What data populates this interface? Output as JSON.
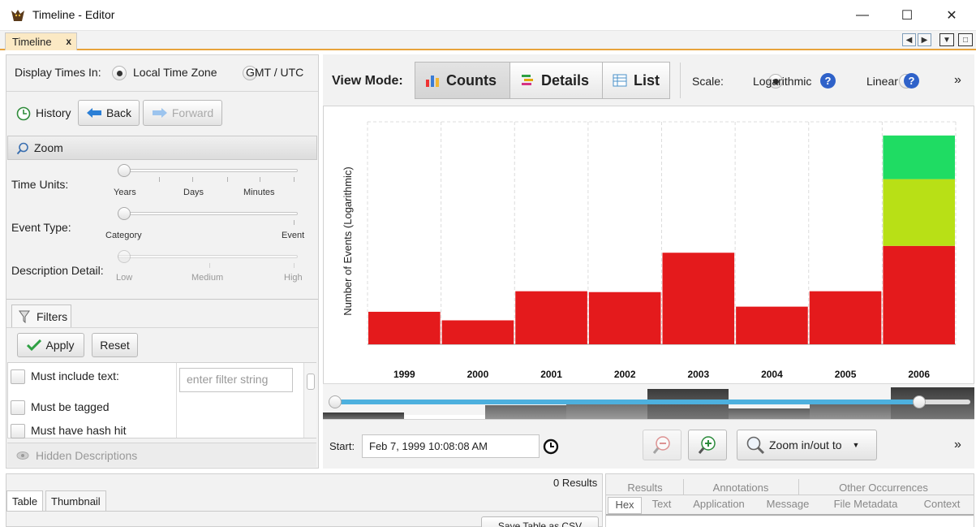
{
  "window": {
    "title": "Timeline - Editor",
    "minimize": "—",
    "maximize": "☐",
    "close": "✕"
  },
  "tabs": {
    "active_label": "Timeline",
    "close_glyph": "x",
    "nav_prev": "◀",
    "nav_next": "▶",
    "dropdown": "▼",
    "restore": "□"
  },
  "left": {
    "display_times_label": "Display Times In:",
    "tz_local": "Local Time Zone",
    "tz_gmt": "GMT / UTC",
    "tz_selected": "Local Time Zone",
    "history_label": "History",
    "back_label": "Back",
    "forward_label": "Forward",
    "zoom_label": "Zoom",
    "time_units_label": "Time Units:",
    "time_units_ticks": [
      "Years",
      "Days",
      "Minutes"
    ],
    "time_units_value": "Years",
    "event_type_label": "Event Type:",
    "event_type_ticks": [
      "Category",
      "Event"
    ],
    "event_type_value": "Category",
    "desc_detail_label": "Description Detail:",
    "desc_detail_ticks": [
      "Low",
      "Medium",
      "High"
    ],
    "desc_detail_value": "Low",
    "filters_label": "Filters",
    "apply_label": "Apply",
    "reset_label": "Reset",
    "filter_items": [
      "Must include text:",
      "Must be tagged",
      "Must have hash hit"
    ],
    "filter_placeholder": "enter filter string",
    "hidden_desc_label": "Hidden Descriptions"
  },
  "viewmode": {
    "label": "View Mode:",
    "modes": [
      "Counts",
      "Details",
      "List"
    ],
    "active": "Counts",
    "scale_label": "Scale:",
    "scale_log": "Logarithmic",
    "scale_linear": "Linear",
    "scale_selected": "Logarithmic",
    "help_glyph": "?",
    "overflow": "»"
  },
  "chart_data": {
    "type": "bar",
    "stacked": true,
    "scale": "logarithmic",
    "ylabel": "Number of Events (Logarithmic)",
    "categories": [
      "1999",
      "2000",
      "2001",
      "2002",
      "2003",
      "2004",
      "2005",
      "2006"
    ],
    "series": [
      {
        "color": "#e41a1c",
        "values": [
          0.38,
          0.28,
          0.62,
          0.61,
          1.07,
          0.44,
          0.62,
          1.15
        ]
      },
      {
        "color": "#b8e016",
        "values": [
          0,
          0,
          0,
          0,
          0,
          0,
          0,
          0.78
        ]
      },
      {
        "color": "#1fdc63",
        "values": [
          0,
          0,
          0,
          0,
          0,
          0,
          0,
          0.51
        ]
      }
    ],
    "ylim": [
      0,
      2.6
    ],
    "grid": true
  },
  "range_slider": {
    "low": 0.0,
    "high": 0.92
  },
  "bottom": {
    "start_label": "Start:",
    "start_value": "Feb 7, 1999 10:08:08 AM",
    "zoom_combo": "Zoom in/out to",
    "overflow": "»"
  },
  "lower": {
    "results": "0  Results",
    "table_tab": "Table",
    "thumbnail_tab": "Thumbnail",
    "save_csv": "Save Table as CSV",
    "top_tabs": [
      "Results",
      "Annotations",
      "Other Occurrences"
    ],
    "bottom_tabs": [
      "Hex",
      "Text",
      "Application",
      "Message",
      "File Metadata",
      "Context"
    ]
  },
  "colors": {
    "accent": "#e8a33b",
    "bar_red": "#e41a1c",
    "bar_yellow": "#b8e016",
    "bar_green": "#1fdc63",
    "slider_blue": "#4db0de"
  }
}
